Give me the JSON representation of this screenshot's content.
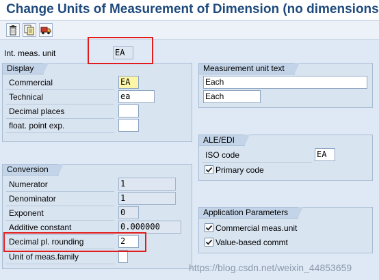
{
  "title": "Change Units of Measurement of Dimension (no dimensions): Det",
  "toolbar": {
    "buttons": [
      {
        "icon": "trash-icon"
      },
      {
        "icon": "copy-icon"
      },
      {
        "icon": "truck-icon"
      }
    ]
  },
  "header": {
    "int_meas_label": "Int. meas. unit",
    "int_meas_value": "EA"
  },
  "display": {
    "title": "Display",
    "commercial_label": "Commercial",
    "commercial_value": "EA",
    "technical_label": "Technical",
    "technical_value": "ea",
    "decimal_places_label": "Decimal places",
    "decimal_places_value": "",
    "float_exp_label": "float. point exp.",
    "float_exp_value": ""
  },
  "measurement_text": {
    "title": "Measurement unit text",
    "long_text": "Each",
    "short_text": "Each"
  },
  "ale_edi": {
    "title": "ALE/EDI",
    "iso_code_label": "ISO code",
    "iso_code_value": "EA",
    "primary_code_label": "Primary code",
    "primary_code_checked": true
  },
  "conversion": {
    "title": "Conversion",
    "numerator_label": "Numerator",
    "numerator_value": "1",
    "denominator_label": "Denominator",
    "denominator_value": "1",
    "exponent_label": "Exponent",
    "exponent_value": "0",
    "additive_label": "Additive constant",
    "additive_value": "0.000000",
    "rounding_label": "Decimal pl. rounding",
    "rounding_value": "2",
    "family_label": "Unit of meas.family",
    "family_value": ""
  },
  "app_params": {
    "title": "Application Parameters",
    "commercial_meas_label": "Commercial meas.unit",
    "commercial_meas_checked": true,
    "value_based_label": "Value-based commt",
    "value_based_checked": true
  },
  "watermark": "https://blog.csdn.net/weixin_44853659",
  "colors": {
    "highlight": "#e21c1c",
    "title": "#1f4a7d",
    "background": "#dfe9f5"
  }
}
